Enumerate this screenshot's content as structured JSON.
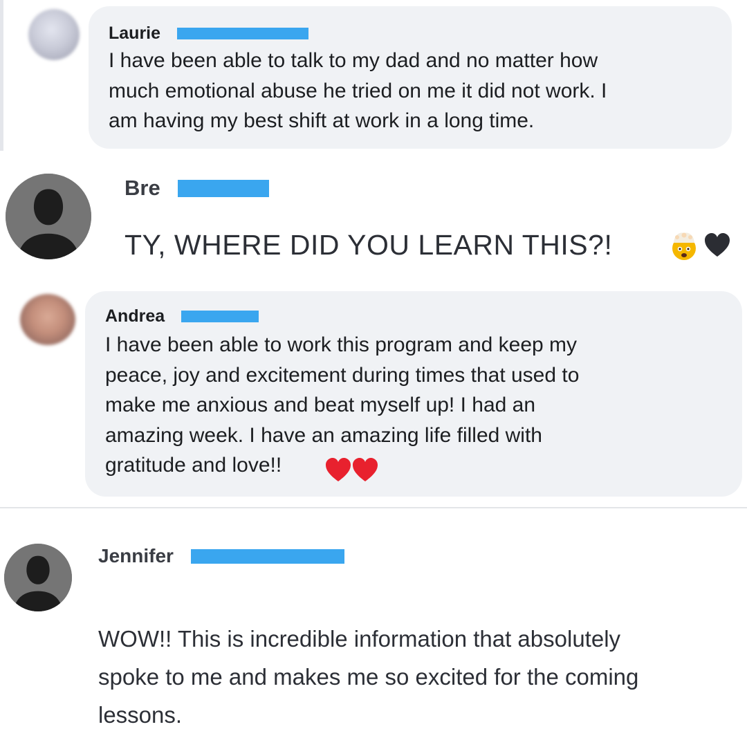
{
  "comments": [
    {
      "name": "Laurie",
      "text": "I have been able to talk to my dad and no matter how\nmuch emotional abuse he tried on me it did not work. I\nam having my best shift at work in a long time."
    },
    {
      "name": "Bre",
      "text": "TY, WHERE DID YOU LEARN THIS?!",
      "emojis": [
        "exploding-head-emoji",
        "black-heart-emoji"
      ]
    },
    {
      "name": "Andrea",
      "text": "I have been able to work this program and keep my\npeace, joy and excitement during times that used to\nmake me anxious and beat myself up! I had an\namazing week. I have an amazing life filled with\ngratitude and love!!",
      "emojis": [
        "red-heart-emoji",
        "red-heart-emoji"
      ]
    },
    {
      "name": "Jennifer",
      "text": "WOW!! This is incredible information that absolutely\nspoke to me and makes me so excited for the coming\nlessons."
    }
  ],
  "colors": {
    "bubble": "#f0f2f5",
    "redaction": "#3aa6ef",
    "avatar_silhouette_bg": "#757575",
    "heart_red": "#e8212e",
    "heart_black": "#2b2d33"
  }
}
